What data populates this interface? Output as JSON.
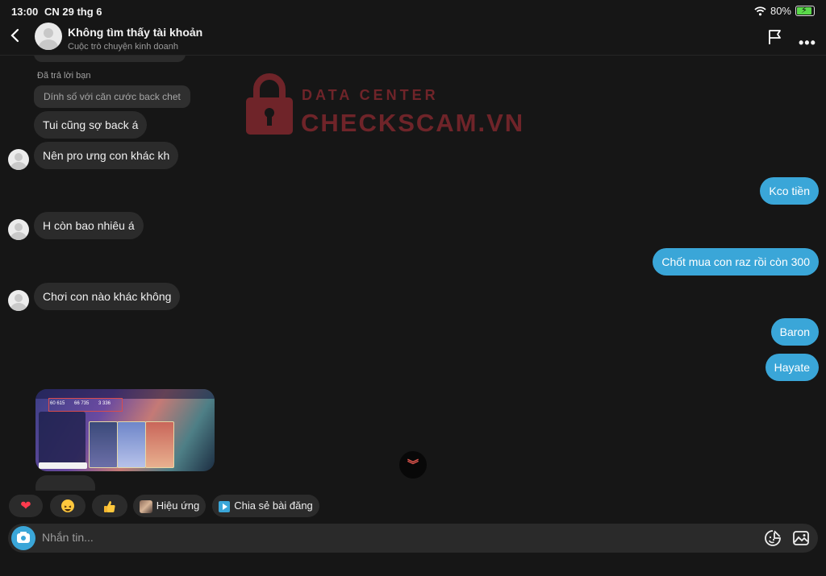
{
  "status_bar": {
    "time": "13:00",
    "date": "CN 29 thg 6",
    "battery": "80%",
    "icons": [
      "wifi-icon",
      "battery-charging-icon"
    ]
  },
  "header": {
    "title": "Không tìm thấy tài khoản",
    "subtitle": "Cuộc trò chuyện kinh doanh",
    "icons": [
      "back-icon",
      "flag-icon",
      "more-icon"
    ]
  },
  "watermark": {
    "small": "DATA CENTER",
    "large": "CHECKSCAM.VN"
  },
  "messages": {
    "reply_label": "Đã trả lời bạn",
    "quoted": "Dính số với căn cước back chet",
    "m1": "Tui cũng sợ back á",
    "m2": "Nên pro ưng con khác kh",
    "m3": "Kco tiền",
    "m4": "H còn bao nhiêu á",
    "m5": "Chốt mua con raz rồi còn 300",
    "m6": "Chơi con nào khác không",
    "m7": "Baron",
    "m8": "Hayate"
  },
  "media": {
    "stats": [
      "60 615",
      "66 735",
      "3 336"
    ]
  },
  "quick_replies": {
    "effects": "Hiệu ứng",
    "share_post": "Chia sẻ bài đăng"
  },
  "composer": {
    "placeholder": "Nhắn tin..."
  },
  "colors": {
    "background": "#161616",
    "incoming_bubble": "#2b2b2b",
    "outgoing_bubble": "#3aa6d8",
    "watermark": "#b8313a"
  }
}
